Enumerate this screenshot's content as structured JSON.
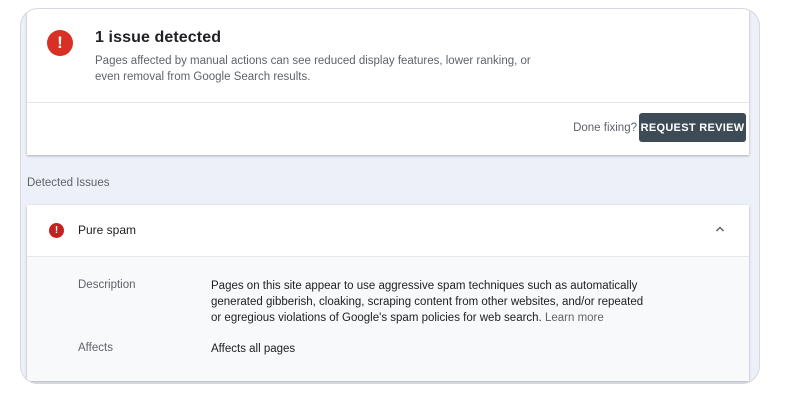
{
  "summary": {
    "alert_icon": "exclamation-icon",
    "title": "1 issue detected",
    "description_line1": "Pages affected by manual actions can see reduced display features, lower ranking, or",
    "description_line2": "even removal from Google Search results.",
    "done_fixing": "Done fixing?",
    "request_review": "REQUEST REVIEW"
  },
  "section_label": "Detected Issues",
  "issue": {
    "icon": "exclamation-icon",
    "title": "Pure spam",
    "toggle_icon": "chevron-up-icon",
    "description_label": "Description",
    "description_line1": "Pages on this site appear to use aggressive spam techniques such as automatically",
    "description_line2": "generated gibberish, cloaking, scraping content from other websites, and/or repeated",
    "description_line3": "or egregious violations of Google's spam policies for web search.",
    "learn_more": "Learn more",
    "affects_label": "Affects",
    "affects_value": "Affects all pages"
  },
  "colors": {
    "error_red": "#d93025",
    "button_dark": "#3c4b55",
    "page_background": "#edf0f9"
  }
}
